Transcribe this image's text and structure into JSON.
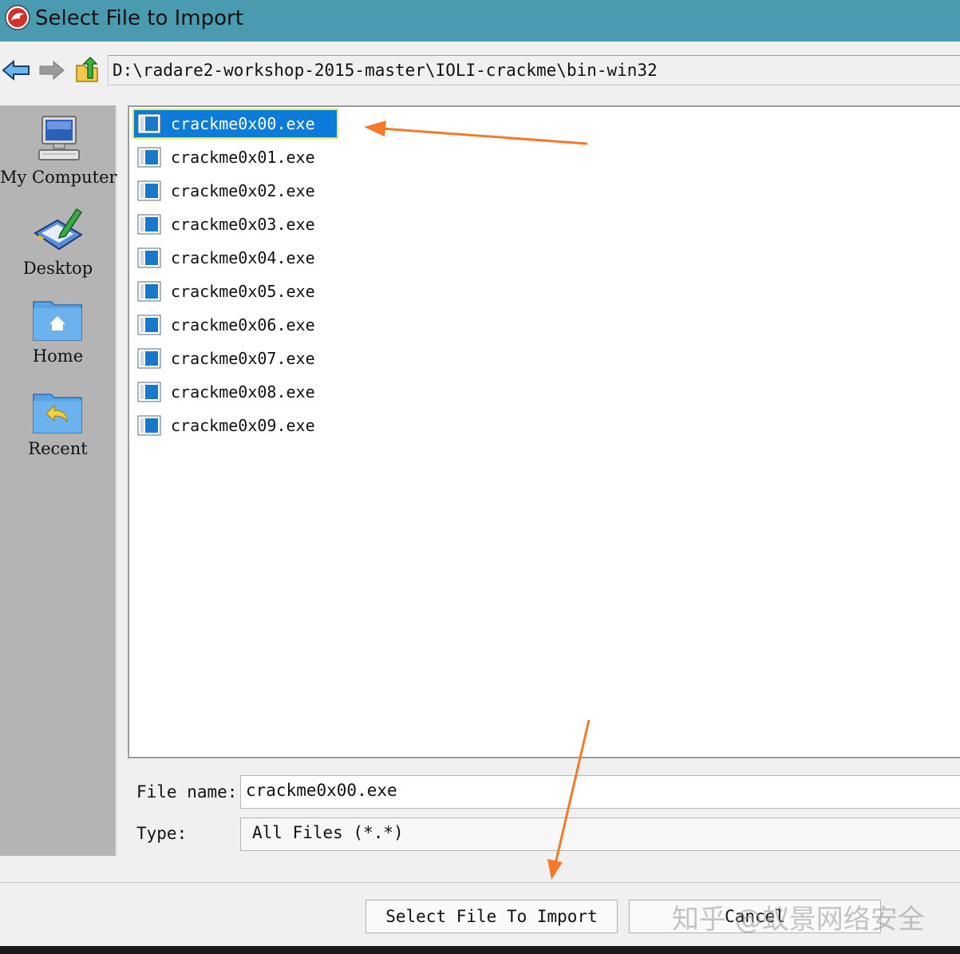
{
  "window": {
    "title": "Select File to Import"
  },
  "toolbar": {
    "path": "D:\\radare2-workshop-2015-master\\IOLI-crackme\\bin-win32",
    "back_icon": "back-arrow-icon",
    "forward_icon": "forward-arrow-icon",
    "up_icon": "up-folder-icon"
  },
  "sidebar": {
    "items": [
      {
        "label": "My Computer",
        "icon": "computer-icon"
      },
      {
        "label": "Desktop",
        "icon": "desktop-icon"
      },
      {
        "label": "Home",
        "icon": "home-folder-icon"
      },
      {
        "label": "Recent",
        "icon": "recent-folder-icon"
      }
    ]
  },
  "files": [
    {
      "name": "crackme0x00.exe",
      "selected": true
    },
    {
      "name": "crackme0x01.exe",
      "selected": false
    },
    {
      "name": "crackme0x02.exe",
      "selected": false
    },
    {
      "name": "crackme0x03.exe",
      "selected": false
    },
    {
      "name": "crackme0x04.exe",
      "selected": false
    },
    {
      "name": "crackme0x05.exe",
      "selected": false
    },
    {
      "name": "crackme0x06.exe",
      "selected": false
    },
    {
      "name": "crackme0x07.exe",
      "selected": false
    },
    {
      "name": "crackme0x08.exe",
      "selected": false
    },
    {
      "name": "crackme0x09.exe",
      "selected": false
    }
  ],
  "form": {
    "file_name_label": "File name:",
    "file_name_value": "crackme0x00.exe",
    "type_label": "Type:",
    "type_value": "All Files (*.*)"
  },
  "buttons": {
    "import_label": "Select File To Import",
    "cancel_label": "Cancel"
  },
  "watermark": "知乎 @蚁景网络安全",
  "colors": {
    "titlebar": "#4a9bb0",
    "selection": "#0c7bd9",
    "annotation_arrow": "#f47a2a",
    "sidebar": "#b4b4b4"
  }
}
